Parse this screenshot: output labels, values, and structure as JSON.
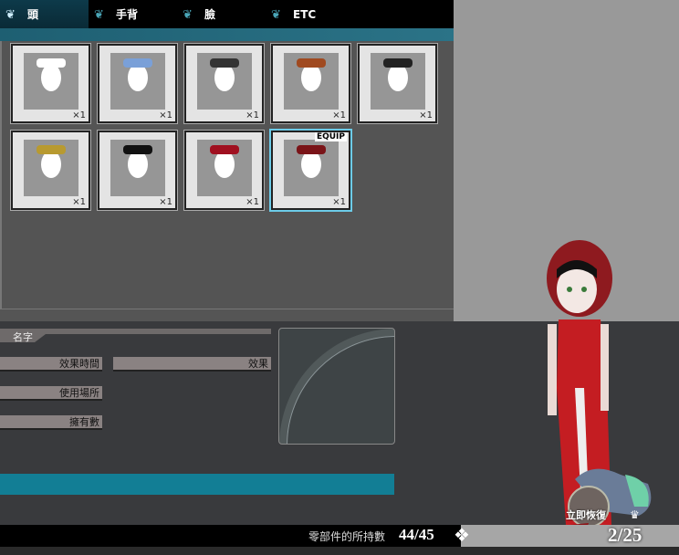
{
  "tabs": [
    {
      "label": "頭",
      "active": true
    },
    {
      "label": "手背"
    },
    {
      "label": "臉"
    },
    {
      "label": "ETC"
    }
  ],
  "items": [
    {
      "count": "×1",
      "color": "#ffffff"
    },
    {
      "count": "×1",
      "color": "#7aa0d8"
    },
    {
      "count": "×1",
      "color": "#333333"
    },
    {
      "count": "×1",
      "color": "#a04a20"
    },
    {
      "count": "×1",
      "color": "#222222"
    },
    {
      "count": "×1",
      "color": "#b89a30"
    },
    {
      "count": "×1",
      "color": "#111111"
    },
    {
      "count": "×1",
      "color": "#a01020"
    },
    {
      "count": "×1",
      "color": "#7a1418",
      "equip": "EQUIP"
    }
  ],
  "details": {
    "name_label": "名字",
    "duration_label": "效果時間",
    "effect_label": "效果",
    "location_label": "使用場所",
    "owned_label": "擁有數"
  },
  "status": {
    "label": "零部件的所持數",
    "value": "44/45"
  },
  "recover_button": "立即恢復",
  "stamina": "2/25"
}
